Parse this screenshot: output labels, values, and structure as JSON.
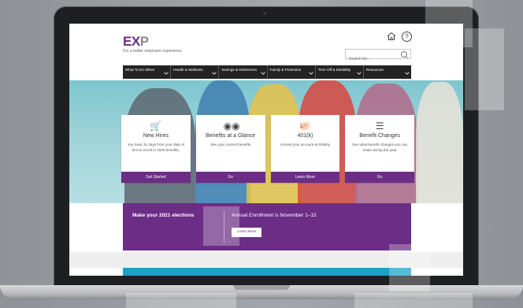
{
  "header": {
    "logo_text": "EX",
    "logo_accent": "P",
    "tagline": "For a better employee experience",
    "search_placeholder": "Search for..."
  },
  "nav": {
    "items": [
      {
        "label": "What To Do When"
      },
      {
        "label": "Health & Wellness"
      },
      {
        "label": "Savings & Retirement"
      },
      {
        "label": "Family & Protection"
      },
      {
        "label": "Time Off & Disability"
      },
      {
        "label": "Resources"
      }
    ]
  },
  "cards": [
    {
      "title": "New Hires",
      "description": "You have 31 days from your date of hire to enroll in 2020 benefits.",
      "button": "Get Started",
      "icon": "cart-icon"
    },
    {
      "title": "Benefits at a Glance",
      "description": "See your current benefits",
      "button": "Go",
      "icon": "binoculars-icon"
    },
    {
      "title": "401(k)",
      "description": "Access your account at Fidelity",
      "button": "Learn More",
      "icon": "piggy-bank-icon"
    },
    {
      "title": "Benefit Changes",
      "description": "See what benefit changes you can make during the year",
      "button": "Go",
      "icon": "checklist-icon"
    }
  ],
  "banner": {
    "left_text": "Make your 2021 elections",
    "right_text": "Annual Enrollment is November 1–15",
    "button": "Learn More"
  },
  "colors": {
    "brand_purple": "#6b2d86",
    "nav_bg": "#232323",
    "hero_teal": "#7ec6cf",
    "accent_blue": "#1aa0c9"
  }
}
